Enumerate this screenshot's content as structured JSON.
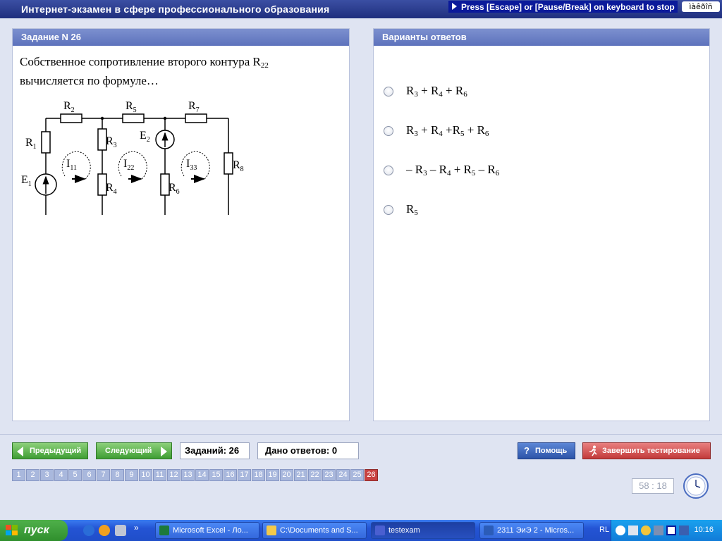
{
  "window": {
    "title": "Интернет-экзамен в сфере профессионального образования",
    "escape_hint": "Press [Escape] or [Pause/Break] on keyboard to stop",
    "lang_box": "ìàêðîñ"
  },
  "question": {
    "header": "Задание N 26",
    "text_line1": "Собственное сопротивление второго контура R",
    "text_sub": "22",
    "text_line2": "вычисляется по формуле…",
    "circuit": {
      "R1": "R",
      "R1_sub": "1",
      "R2": "R",
      "R2_sub": "2",
      "R3": "R",
      "R3_sub": "3",
      "R4": "R",
      "R4_sub": "4",
      "R5": "R",
      "R5_sub": "5",
      "R6": "R",
      "R6_sub": "6",
      "R7": "R",
      "R7_sub": "7",
      "R8": "R",
      "R8_sub": "8",
      "E1": "E",
      "E1_sub": "1",
      "E2": "E",
      "E2_sub": "2",
      "I11": "I",
      "I11_sub": "11",
      "I22": "I",
      "I22_sub": "22",
      "I33": "I",
      "I33_sub": "33"
    }
  },
  "answers": {
    "header": "Варианты ответов",
    "options": [
      {
        "parts": [
          [
            "",
            "R",
            "3"
          ],
          [
            " + ",
            "R",
            "4"
          ],
          [
            " + ",
            "R",
            "6"
          ]
        ]
      },
      {
        "parts": [
          [
            "",
            "R",
            "3"
          ],
          [
            " + ",
            "R",
            "4"
          ],
          [
            " +",
            "R",
            "5"
          ],
          [
            " + ",
            "R",
            "6"
          ]
        ]
      },
      {
        "parts": [
          [
            "– ",
            "R",
            "3"
          ],
          [
            " – ",
            "R",
            "4"
          ],
          [
            " + ",
            "R",
            "5"
          ],
          [
            " – ",
            "R",
            "6"
          ]
        ]
      },
      {
        "parts": [
          [
            "",
            "R",
            "5"
          ]
        ]
      }
    ]
  },
  "controls": {
    "prev_label": "Предыдущий",
    "next_label": "Следующий",
    "tasks_count": "Заданий: 26",
    "answers_given": "Дано ответов: 0",
    "help_label": "Помощь",
    "finish_label": "Завершить тестирование",
    "timer": "58 : 18",
    "pages": [
      "1",
      "2",
      "3",
      "4",
      "5",
      "6",
      "7",
      "8",
      "9",
      "10",
      "11",
      "12",
      "13",
      "14",
      "15",
      "16",
      "17",
      "18",
      "19",
      "20",
      "21",
      "22",
      "23",
      "24",
      "25",
      "26"
    ],
    "current_page": "26"
  },
  "taskbar": {
    "start_label": "пуск",
    "tasks": [
      {
        "label": "Microsoft Excel - Ло...",
        "icon": "excel-icon",
        "active": false
      },
      {
        "label": "C:\\Documents and S...",
        "icon": "folder-icon",
        "active": false
      },
      {
        "label": "testexam",
        "icon": "testexam-icon",
        "active": true
      },
      {
        "label": "2311 ЭиЭ 2 - Micros...",
        "icon": "word-icon",
        "active": false
      }
    ],
    "lang": "RL",
    "clock": "10:16"
  },
  "colors": {
    "title_bar": "#1f2f7e",
    "panel_header": "#6a7fc6",
    "main_bg": "#dfe4f2",
    "green_button": "#3e9d33",
    "help_button": "#2c54a8",
    "finish_button": "#c23a3a",
    "current_page": "#c94141",
    "taskbar": "#2454d4"
  }
}
